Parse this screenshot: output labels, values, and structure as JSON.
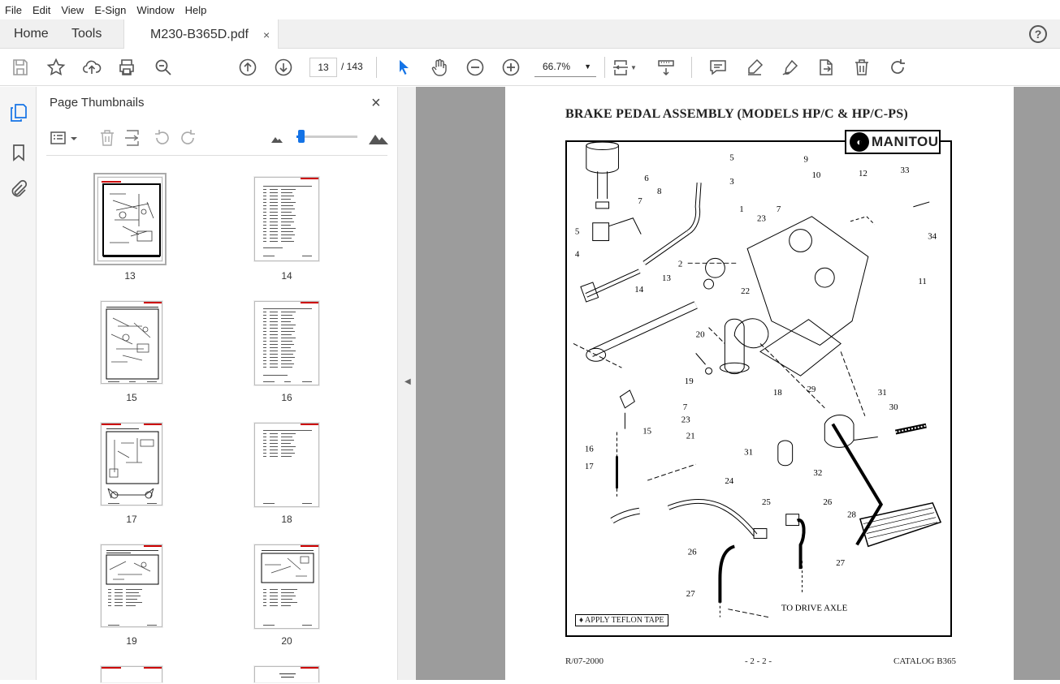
{
  "menu": [
    "File",
    "Edit",
    "View",
    "E-Sign",
    "Window",
    "Help"
  ],
  "tabs": {
    "home": "Home",
    "tools": "Tools",
    "document": "M230-B365D.pdf",
    "close": "×",
    "help": "?"
  },
  "toolbar": {
    "current_page": "13",
    "total_pages": "/ 143",
    "zoom": "66.7%",
    "icons": [
      "save-icon",
      "star-icon",
      "upload-icon",
      "print-icon",
      "zoom-search-icon",
      "page-up-icon",
      "page-down-icon",
      "select-pointer-icon",
      "hand-icon",
      "zoom-out-icon",
      "zoom-in-icon",
      "fit-page-icon",
      "scroll-mode-icon",
      "comment-icon",
      "highlight-icon",
      "sign-icon",
      "export-icon",
      "delete-icon",
      "rotate-icon"
    ]
  },
  "panel": {
    "title": "Page Thumbnails",
    "close": "×",
    "thumbnails": [
      {
        "label": "13",
        "selected": true
      },
      {
        "label": "14",
        "selected": false
      },
      {
        "label": "15",
        "selected": false
      },
      {
        "label": "16",
        "selected": false
      },
      {
        "label": "17",
        "selected": false
      },
      {
        "label": "18",
        "selected": false
      },
      {
        "label": "19",
        "selected": false
      },
      {
        "label": "20",
        "selected": false
      }
    ]
  },
  "document": {
    "title": "BRAKE PEDAL ASSEMBLY (MODELS HP/C & HP/C-PS)",
    "logo": "MANITOU",
    "teflon_note": "♦ APPLY TEFLON TAPE",
    "drive_axle": "TO DRIVE AXLE",
    "footer_left": "R/07-2000",
    "footer_center": "- 2 - 2 -",
    "footer_right": "CATALOG B365",
    "callouts": [
      "5",
      "6",
      "3",
      "8",
      "7",
      "5",
      "4",
      "2",
      "1",
      "9",
      "10",
      "12",
      "33",
      "7",
      "23",
      "34",
      "13",
      "14",
      "22",
      "11",
      "20",
      "19",
      "18",
      "7",
      "23",
      "21",
      "16",
      "15",
      "17",
      "29",
      "31",
      "30",
      "31",
      "32",
      "24",
      "25",
      "26",
      "28",
      "26",
      "27",
      "27"
    ]
  },
  "colors": {
    "accent": "#1473e6",
    "brand_red": "#cc0000",
    "viewer_bg": "#9c9c9c"
  }
}
